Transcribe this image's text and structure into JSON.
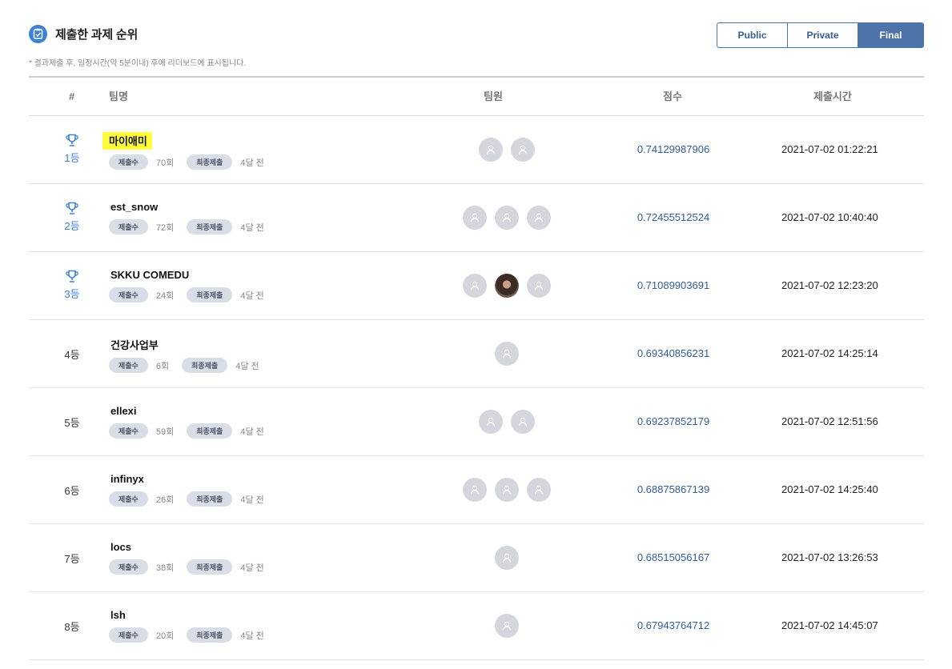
{
  "header": {
    "title": "제출한 과제 순위",
    "notice": "* 결과제출 후, 일정시간(약 5분이내) 후에 리더보드에 표시됩니다.",
    "tabs": [
      "Public",
      "Private",
      "Final"
    ],
    "active_tab": "Final"
  },
  "columns": {
    "rank": "#",
    "team": "팀명",
    "members": "팀원",
    "score": "점수",
    "time": "제출시간"
  },
  "labels": {
    "submissions_badge": "제출수",
    "last_submission_badge": "최종제출"
  },
  "rows": [
    {
      "rank": "1등",
      "team": "마이애미",
      "highlighted": true,
      "count": "70회",
      "ago": "4달 전",
      "members": [
        "default",
        "default"
      ],
      "score": "0.74129987906",
      "time": "2021-07-02 01:22:21"
    },
    {
      "rank": "2등",
      "team": "est_snow",
      "count": "72회",
      "ago": "4달 전",
      "members": [
        "default",
        "default",
        "default"
      ],
      "score": "0.72455512524",
      "time": "2021-07-02 10:40:40"
    },
    {
      "rank": "3등",
      "team": "SKKU COMEDU",
      "count": "24회",
      "ago": "4달 전",
      "members": [
        "default",
        "photo",
        "default"
      ],
      "score": "0.71089903691",
      "time": "2021-07-02 12:23:20"
    },
    {
      "rank": "4등",
      "team": "건강사업부",
      "count": "6회",
      "ago": "4달 전",
      "members": [
        "default"
      ],
      "score": "0.69340856231",
      "time": "2021-07-02 14:25:14"
    },
    {
      "rank": "5등",
      "team": "ellexi",
      "count": "59회",
      "ago": "4달 전",
      "members": [
        "default",
        "default"
      ],
      "score": "0.69237852179",
      "time": "2021-07-02 12:51:56"
    },
    {
      "rank": "6등",
      "team": "infinyx",
      "count": "26회",
      "ago": "4달 전",
      "members": [
        "default",
        "default",
        "default"
      ],
      "score": "0.68875867139",
      "time": "2021-07-02 14:25:40"
    },
    {
      "rank": "7등",
      "team": "locs",
      "count": "38회",
      "ago": "4달 전",
      "members": [
        "default"
      ],
      "score": "0.68515056167",
      "time": "2021-07-02 13:26:53"
    },
    {
      "rank": "8등",
      "team": "lsh",
      "count": "20회",
      "ago": "4달 전",
      "members": [
        "default"
      ],
      "score": "0.67943764712",
      "time": "2021-07-02 14:45:07"
    }
  ],
  "colors": {
    "accent": "#3b82d6",
    "tab_active": "#4e73a8",
    "score_text": "#2e5e9a",
    "highlight": "#fffc3a",
    "avatar_default": "#d3d6dc"
  },
  "icons": {
    "title": "clipboard-check-icon",
    "rank_top": "trophy-icon",
    "member": "user-avatar-icon"
  }
}
